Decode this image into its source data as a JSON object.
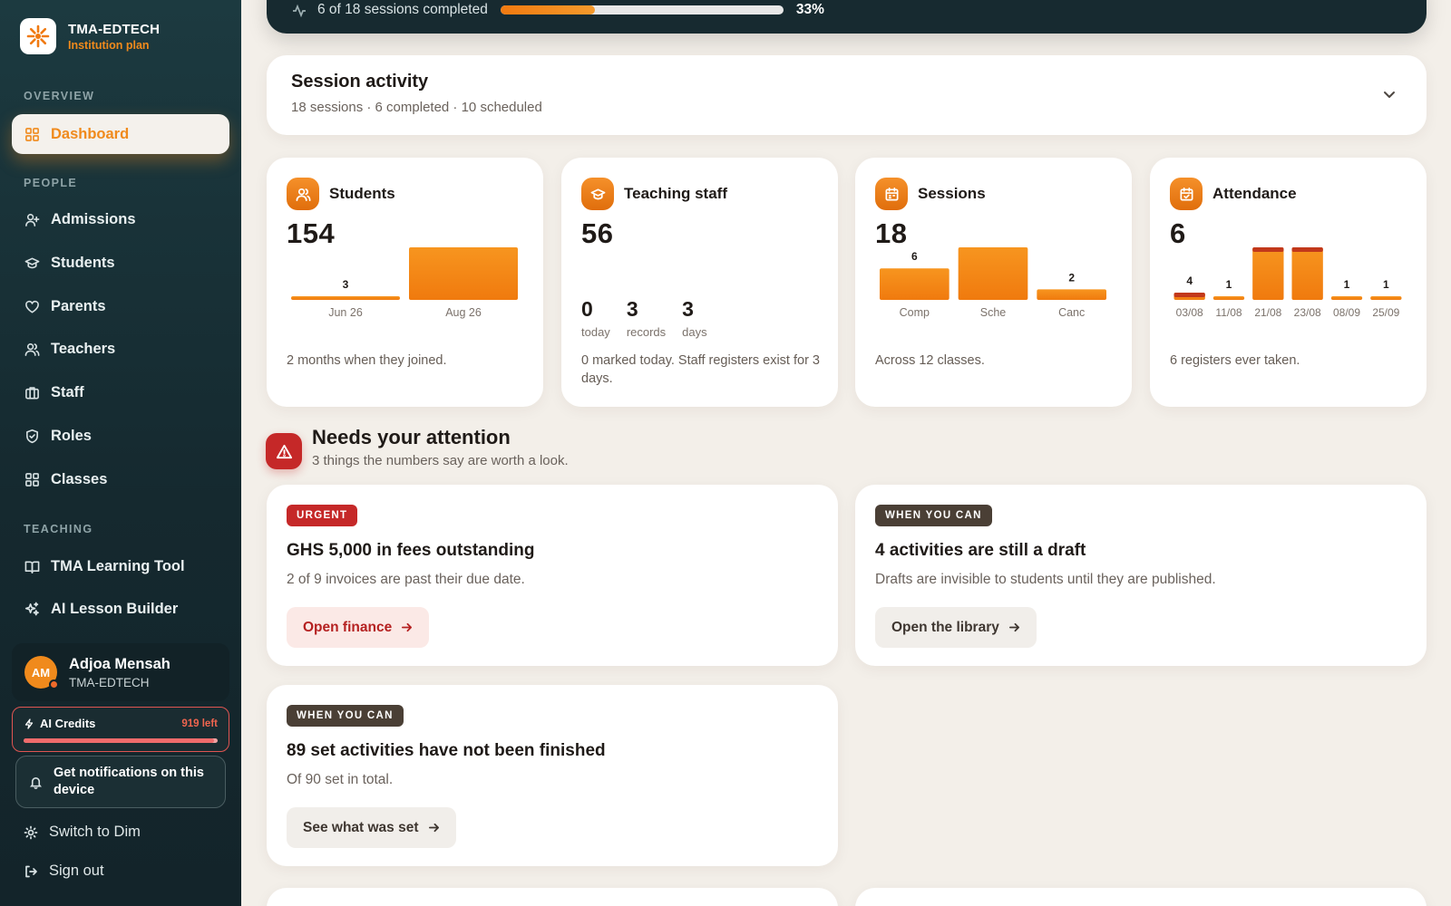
{
  "brand": {
    "name": "TMA-EDTECH",
    "plan": "Institution plan"
  },
  "sidebar": {
    "sections": {
      "overview": "OVERVIEW",
      "people": "PEOPLE",
      "teaching": "TEACHING"
    },
    "items": [
      {
        "label": "Dashboard",
        "icon": "dashboard-icon",
        "active": true
      },
      {
        "label": "Admissions",
        "icon": "user-plus-icon"
      },
      {
        "label": "Students",
        "icon": "graduation-cap-icon"
      },
      {
        "label": "Parents",
        "icon": "heart-icon"
      },
      {
        "label": "Teachers",
        "icon": "users-icon"
      },
      {
        "label": "Staff",
        "icon": "briefcase-icon"
      },
      {
        "label": "Roles",
        "icon": "shield-icon"
      },
      {
        "label": "Classes",
        "icon": "grid-icon"
      },
      {
        "label": "TMA Learning Tool",
        "icon": "book-open-icon"
      },
      {
        "label": "AI Lesson Builder",
        "icon": "sparkles-icon"
      }
    ],
    "user": {
      "initials": "AM",
      "name": "Adjoa Mensah",
      "org": "TMA-EDTECH"
    },
    "credits": {
      "title": "AI Credits",
      "left": "919 left",
      "fraction": 0.98
    },
    "notify": "Get notifications on this device",
    "switch_theme": "Switch to Dim",
    "sign_out": "Sign out"
  },
  "progress": {
    "text": "6 of 18 sessions completed",
    "percent_label": "33%",
    "fraction": 0.333
  },
  "session_activity": {
    "title": "Session activity",
    "subtitle": "18 sessions · 6 completed · 10 scheduled"
  },
  "stats": {
    "students": {
      "title": "Students",
      "value": "154",
      "note": "2 months when they joined.",
      "chart_data": {
        "type": "bar",
        "categories": [
          "Jun 26",
          "Aug 26"
        ],
        "values": [
          3,
          151
        ]
      }
    },
    "teaching_staff": {
      "title": "Teaching staff",
      "value": "56",
      "mini": [
        {
          "value": "0",
          "label": "today"
        },
        {
          "value": "3",
          "label": "records"
        },
        {
          "value": "3",
          "label": "days"
        }
      ],
      "note": "0 marked today. Staff registers exist for 3 days."
    },
    "sessions": {
      "title": "Sessions",
      "value": "18",
      "note": "Across 12 classes.",
      "chart_data": {
        "type": "bar",
        "categories": [
          "Comp",
          "Sche",
          "Canc"
        ],
        "values": [
          6,
          10,
          2
        ]
      }
    },
    "attendance": {
      "title": "Attendance",
      "value": "6",
      "note": "6 registers ever taken.",
      "chart_data": {
        "type": "bar",
        "categories": [
          "03/08",
          "11/08",
          "21/08",
          "23/08",
          "08/09",
          "25/09"
        ],
        "values": [
          4,
          1,
          29,
          29,
          1,
          1
        ]
      }
    }
  },
  "attention": {
    "title": "Needs your attention",
    "subtitle": "3 things the numbers say are worth a look.",
    "tasks": [
      {
        "badge": "URGENT",
        "title": "GHS 5,000 in fees outstanding",
        "desc": "2 of 9 invoices are past their due date.",
        "button": "Open finance"
      },
      {
        "badge": "WHEN YOU CAN",
        "title": "4 activities are still a draft",
        "desc": "Drafts are invisible to students until they are published.",
        "button": "Open the library"
      },
      {
        "badge": "WHEN YOU CAN",
        "title": "89 set activities have not been finished",
        "desc": "Of 90 set in total.",
        "button": "See what was set"
      }
    ]
  },
  "colors": {
    "accent": "#f08a1c",
    "urgent": "#c52828",
    "sidebar": "#1c3a40"
  }
}
